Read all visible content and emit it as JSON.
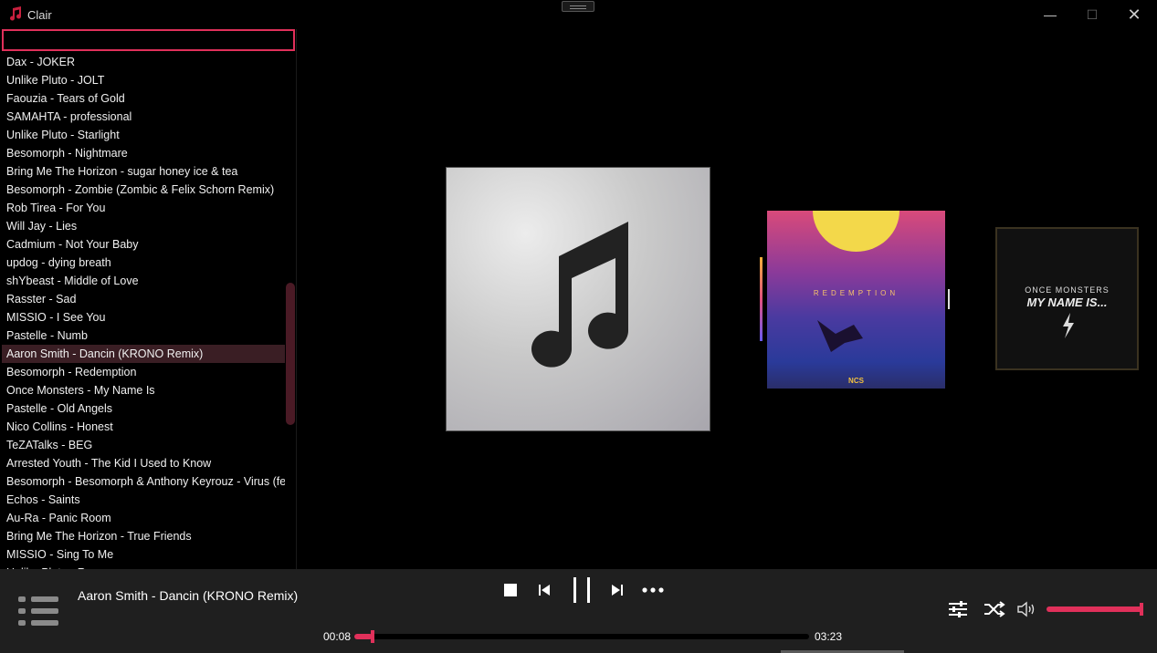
{
  "window": {
    "title": "Clair",
    "min_glyph": "—",
    "max_glyph": "☐",
    "close_glyph": "✕"
  },
  "search": {
    "value": "",
    "placeholder": ""
  },
  "songs": [
    "Dax - JOKER",
    "Unlike Pluto - JOLT",
    "Faouzia - Tears of Gold",
    "SAMAHTA - professional",
    "Unlike Pluto - Starlight",
    "Besomorph - Nightmare",
    "Bring Me The Horizon - sugar honey ice & tea",
    "Besomorph - Zombie (Zombic & Felix Schorn Remix)",
    "Rob Tirea - For You",
    "Will Jay - Lies",
    "Cadmium - Not Your Baby",
    "updog - dying breath",
    "shYbeast - Middle of Love",
    "Rasster - Sad",
    "MISSIO - I See You",
    "Pastelle - Numb",
    "Aaron Smith - Dancin (KRONO Remix)",
    "Besomorph - Redemption",
    "Once Monsters - My Name Is",
    "Pastelle - Old Angels",
    "Nico Collins - Honest",
    "TeZATalks - BEG",
    "Arrested Youth - The Kid I Used to Know",
    "Besomorph - Besomorph & Anthony Keyrouz - Virus (fea",
    "Echos - Saints",
    "Au-Ra - Panic Room",
    "Bring Me The Horizon - True Friends",
    "MISSIO - Sing To Me",
    "Unlike Pluto - Reasons"
  ],
  "selected_index": 16,
  "covers": {
    "redemption_title": "REDEMPTION",
    "redemption_label": "NCS",
    "monsters_line1": "ONCE MONSTERS",
    "monsters_line2": "MY NAME IS..."
  },
  "player": {
    "now_playing": "Aaron Smith - Dancin (KRONO Remix)",
    "current_time": "00:08",
    "total_time": "03:23",
    "progress": 0.04,
    "volume": 1.0
  },
  "icons": {
    "app": "music-note-icon",
    "list": "playlist-icon",
    "stop": "stop-icon",
    "prev": "previous-icon",
    "pause": "pause-icon",
    "next": "next-icon",
    "more": "more-icon",
    "equalizer": "equalizer-icon",
    "shuffle": "shuffle-icon",
    "volume": "volume-icon"
  },
  "colors": {
    "accent": "#e0305a",
    "selected_row": "#3a1e24",
    "bottom_bar": "#1f1f1f"
  }
}
